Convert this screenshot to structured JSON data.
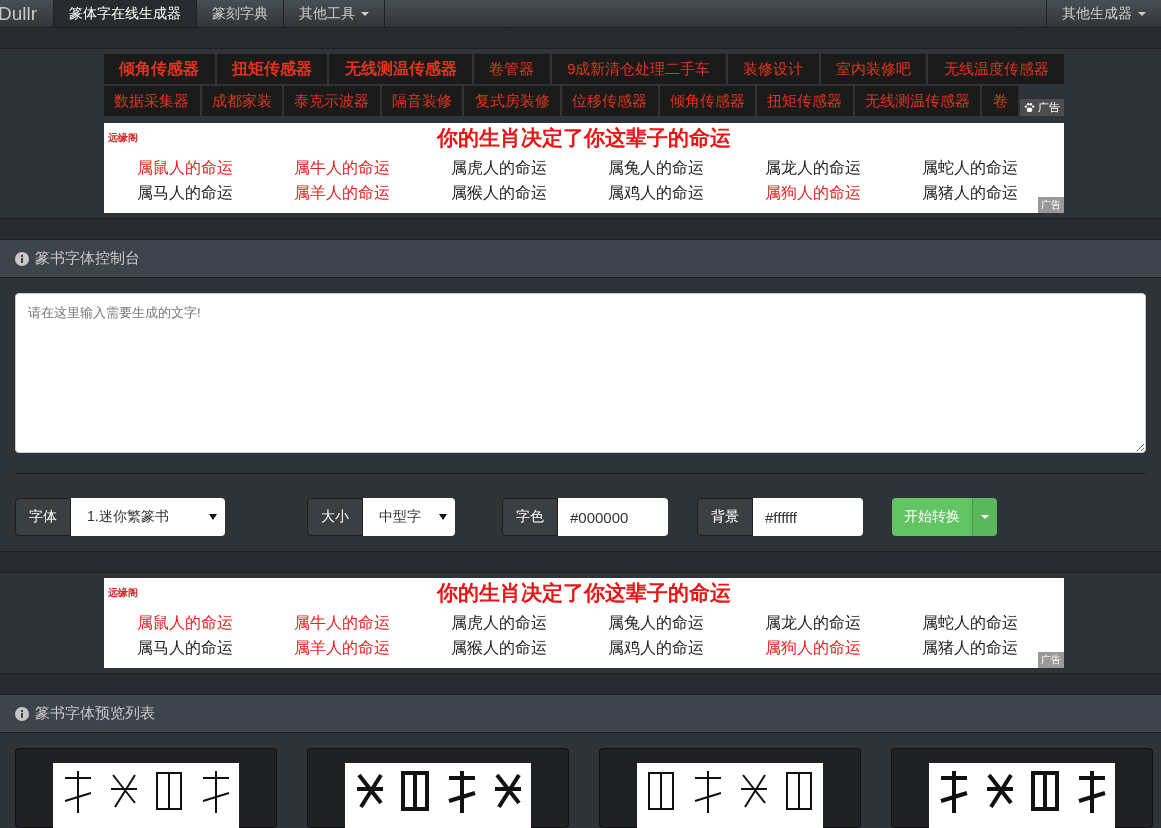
{
  "navbar": {
    "brand": "Dullr",
    "items": [
      {
        "label": "篆体字在线生成器",
        "selected": true,
        "dropdown": false
      },
      {
        "label": "篆刻字典",
        "selected": false,
        "dropdown": false
      },
      {
        "label": "其他工具",
        "selected": false,
        "dropdown": true
      }
    ],
    "right_item": {
      "label": "其他生成器",
      "dropdown": true
    }
  },
  "ad_links": {
    "upper_row": [
      {
        "label": "倾角传感器",
        "bold": true
      },
      {
        "label": "扭矩传感器",
        "bold": true
      },
      {
        "label": "无线测温传感器",
        "bold": true
      },
      {
        "label": "卷管器",
        "bold": false
      },
      {
        "label": "9成新清仓处理二手车",
        "bold": false
      },
      {
        "label": "装修设计",
        "bold": false
      },
      {
        "label": "室内装修吧",
        "bold": false
      },
      {
        "label": "无线温度传感器",
        "bold": false
      }
    ],
    "lower_row": [
      {
        "label": "数据采集器",
        "bold": false
      },
      {
        "label": "成都家装",
        "bold": false
      },
      {
        "label": "泰克示波器",
        "bold": false
      },
      {
        "label": "隔音装修",
        "bold": false
      },
      {
        "label": "复式房装修",
        "bold": false
      },
      {
        "label": "位移传感器",
        "bold": false
      },
      {
        "label": "倾角传感器",
        "bold": false
      },
      {
        "label": "扭矩传感器",
        "bold": false
      },
      {
        "label": "无线测温传感器",
        "bold": false
      },
      {
        "label": "卷",
        "bold": false
      }
    ],
    "badge": "广告"
  },
  "banner_top": {
    "logo": "远缘阁",
    "headline": "你的生肖决定了你这辈子的命运",
    "links": [
      {
        "label": "属鼠人的命运",
        "highlighted": true
      },
      {
        "label": "属牛人的命运",
        "highlighted": true
      },
      {
        "label": "属虎人的命运",
        "highlighted": false
      },
      {
        "label": "属兔人的命运",
        "highlighted": false
      },
      {
        "label": "属龙人的命运",
        "highlighted": false
      },
      {
        "label": "属蛇人的命运",
        "highlighted": false
      },
      {
        "label": "属马人的命运",
        "highlighted": false
      },
      {
        "label": "属羊人的命运",
        "highlighted": true
      },
      {
        "label": "属猴人的命运",
        "highlighted": false
      },
      {
        "label": "属鸡人的命运",
        "highlighted": false
      },
      {
        "label": "属狗人的命运",
        "highlighted": true
      },
      {
        "label": "属猪人的命运",
        "highlighted": false
      }
    ],
    "badge": "广告"
  },
  "control_panel": {
    "title": "篆书字体控制台",
    "textarea": {
      "placeholder": "请在这里输入需要生成的文字!"
    },
    "controls": [
      {
        "kind": "select",
        "label": "字体",
        "value": "1.迷你繁篆书"
      },
      {
        "kind": "select",
        "label": "大小",
        "value": "中型字"
      },
      {
        "kind": "input",
        "label": "字色",
        "value": "#000000"
      },
      {
        "kind": "input",
        "label": "背景",
        "value": "#ffffff"
      }
    ],
    "button": "开始转换"
  },
  "banner_bottom": {
    "logo": "远缘阁",
    "headline": "你的生肖决定了你这辈子的命运",
    "links": [
      {
        "label": "属鼠人的命运",
        "highlighted": true
      },
      {
        "label": "属牛人的命运",
        "highlighted": true
      },
      {
        "label": "属虎人的命运",
        "highlighted": false
      },
      {
        "label": "属兔人的命运",
        "highlighted": false
      },
      {
        "label": "属龙人的命运",
        "highlighted": false
      },
      {
        "label": "属蛇人的命运",
        "highlighted": false
      },
      {
        "label": "属马人的命运",
        "highlighted": false
      },
      {
        "label": "属羊人的命运",
        "highlighted": true
      },
      {
        "label": "属猴人的命运",
        "highlighted": false
      },
      {
        "label": "属鸡人的命运",
        "highlighted": false
      },
      {
        "label": "属狗人的命运",
        "highlighted": true
      },
      {
        "label": "属猪人的命运",
        "highlighted": false
      }
    ],
    "badge": "广告"
  },
  "preview_panel": {
    "title": "篆书字体预览列表"
  }
}
